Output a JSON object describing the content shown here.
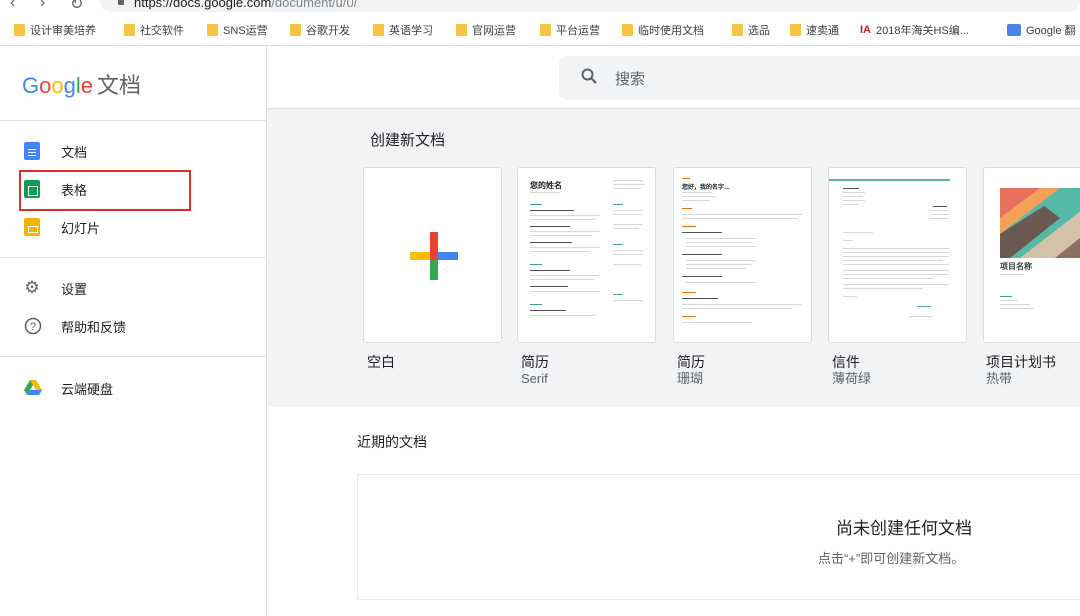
{
  "browser": {
    "url_host": "https://docs.google.com",
    "url_path": "/document/u/0/",
    "bookmarks": [
      {
        "label": "设计审美培养",
        "icon": "folder-icon"
      },
      {
        "label": "社交软件",
        "icon": "folder-icon"
      },
      {
        "label": "SNS运营",
        "icon": "folder-icon"
      },
      {
        "label": "谷歌开发",
        "icon": "folder-icon"
      },
      {
        "label": "英语学习",
        "icon": "folder-icon"
      },
      {
        "label": "官网运营",
        "icon": "folder-icon"
      },
      {
        "label": "平台运营",
        "icon": "folder-icon"
      },
      {
        "label": "临时使用文档",
        "icon": "folder-icon"
      },
      {
        "label": "选品",
        "icon": "folder-icon"
      },
      {
        "label": "速卖通",
        "icon": "folder-icon"
      },
      {
        "label": "2018年海关HS编...",
        "icon": "ia-icon",
        "icon_text": "IA"
      },
      {
        "label": "Google 翻",
        "icon": "google-translate-icon"
      }
    ]
  },
  "app": {
    "logo_letters": [
      "G",
      "o",
      "o",
      "g",
      "l",
      "e"
    ],
    "logo_suffix": "文档"
  },
  "sidebar": {
    "items": [
      {
        "label": "文档",
        "icon": "docs-icon"
      },
      {
        "label": "表格",
        "icon": "sheets-icon",
        "highlighted": true
      },
      {
        "label": "幻灯片",
        "icon": "slides-icon"
      },
      {
        "label": "设置",
        "icon": "gear-icon"
      },
      {
        "label": "帮助和反馈",
        "icon": "help-icon"
      },
      {
        "label": "云端硬盘",
        "icon": "drive-icon"
      }
    ]
  },
  "search": {
    "placeholder": "搜索"
  },
  "templates": {
    "title": "创建新文档",
    "cards": [
      {
        "name": "空白",
        "sub": ""
      },
      {
        "name": "简历",
        "sub": "Serif",
        "preview_heading": "您的姓名"
      },
      {
        "name": "简历",
        "sub": "珊瑚",
        "preview_heading": "您好，我的名字…"
      },
      {
        "name": "信件",
        "sub": "薄荷绿"
      },
      {
        "name": "项目计划书",
        "sub": "热带",
        "preview_heading": "项目名称"
      }
    ]
  },
  "recent": {
    "title": "近期的文档",
    "empty_title": "尚未创建任何文档",
    "empty_sub": "点击“+”即可创建新文档。"
  },
  "colors": {
    "google_blue": "#4285f4",
    "google_red": "#ea4335",
    "google_yellow": "#fbbc05",
    "google_green": "#34a853",
    "highlight_red": "#d93025"
  }
}
